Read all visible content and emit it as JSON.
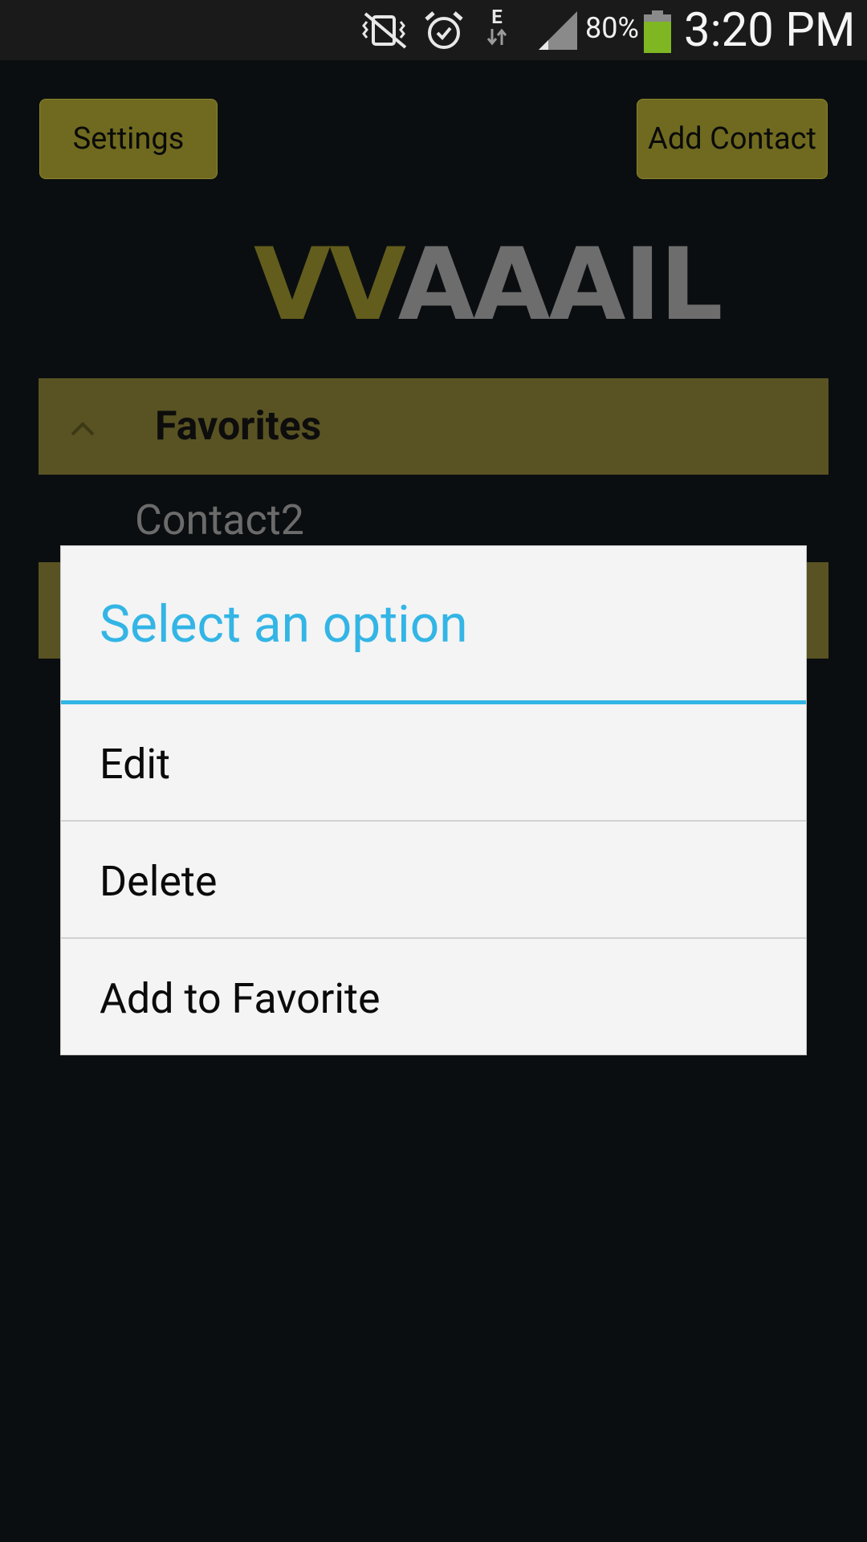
{
  "status_bar": {
    "battery_percent": "80%",
    "time": "3:20 PM",
    "network_type": "E",
    "icons": [
      "no-vibrate-icon",
      "alarm-icon",
      "data-arrows-icon",
      "signal-icon",
      "battery-icon"
    ],
    "battery_color": "#7fb722"
  },
  "toolbar": {
    "settings_label": "Settings",
    "add_contact_label": "Add Contact"
  },
  "logo": {
    "part1": "VV",
    "part2": "AAAIL"
  },
  "contacts": {
    "group_title": "Favorites",
    "items": [
      "Contact2"
    ]
  },
  "dialog": {
    "title": "Select an option",
    "options": [
      "Edit",
      "Delete",
      "Add to Favorite"
    ],
    "accent_color": "#33b5e5"
  }
}
